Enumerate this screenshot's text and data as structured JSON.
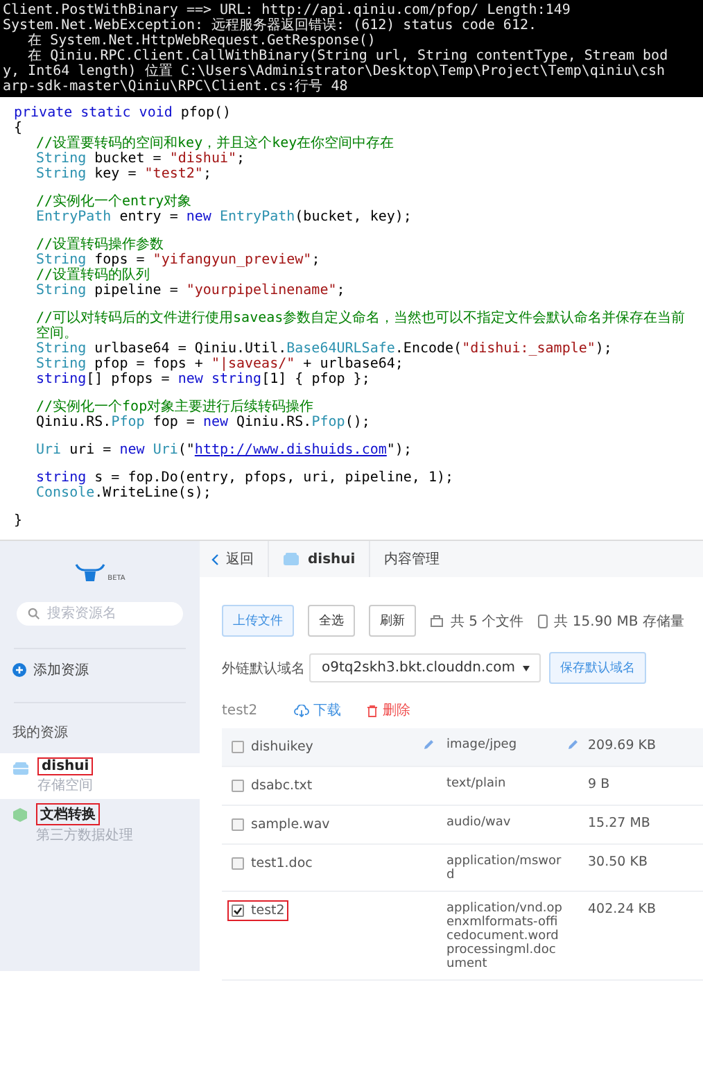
{
  "console": {
    "lines": [
      "Client.PostWithBinary ==> URL: http://api.qiniu.com/pfop/ Length:149",
      "System.Net.WebException: 远程服务器返回错误: (612) status code 612.",
      "   在 System.Net.HttpWebRequest.GetResponse()",
      "   在 Qiniu.RPC.Client.CallWithBinary(String url, String contentType, Stream bod",
      "y, Int64 length) 位置 C:\\Users\\Administrator\\Desktop\\Temp\\Project\\Temp\\qiniu\\csh",
      "arp-sdk-master\\Qiniu\\RPC\\Client.cs:行号 48"
    ]
  },
  "code": {
    "signature": [
      {
        "kind": "kw",
        "text": "private static void"
      },
      {
        "kind": "plain",
        "text": " pfop()"
      }
    ],
    "open_brace": "{",
    "blocks": [
      [
        [
          {
            "kind": "comment",
            "text": "//设置要转码的空间和key，并且这个key在你空间中存在"
          }
        ],
        [
          {
            "kind": "type",
            "text": "String"
          },
          {
            "kind": "plain",
            "text": " bucket = "
          },
          {
            "kind": "str",
            "text": "\"dishui\""
          },
          {
            "kind": "plain",
            "text": ";"
          }
        ],
        [
          {
            "kind": "type",
            "text": "String"
          },
          {
            "kind": "plain",
            "text": " key = "
          },
          {
            "kind": "str",
            "text": "\"test2\""
          },
          {
            "kind": "plain",
            "text": ";"
          }
        ]
      ],
      [
        [
          {
            "kind": "comment",
            "text": "//实例化一个entry对象"
          }
        ],
        [
          {
            "kind": "type",
            "text": "EntryPath"
          },
          {
            "kind": "plain",
            "text": " entry = "
          },
          {
            "kind": "kw",
            "text": "new "
          },
          {
            "kind": "type",
            "text": "EntryPath"
          },
          {
            "kind": "plain",
            "text": "(bucket, key);"
          }
        ]
      ],
      [
        [
          {
            "kind": "comment",
            "text": "//设置转码操作参数"
          }
        ],
        [
          {
            "kind": "type",
            "text": "String"
          },
          {
            "kind": "plain",
            "text": " fops = "
          },
          {
            "kind": "str",
            "text": "\"yifangyun_preview\""
          },
          {
            "kind": "plain",
            "text": ";"
          }
        ],
        [
          {
            "kind": "comment",
            "text": "//设置转码的队列"
          }
        ],
        [
          {
            "kind": "type",
            "text": "String"
          },
          {
            "kind": "plain",
            "text": " pipeline = "
          },
          {
            "kind": "str",
            "text": "\"yourpipelinename\""
          },
          {
            "kind": "plain",
            "text": ";"
          }
        ]
      ],
      [
        [
          {
            "kind": "comment",
            "text": "//可以对转码后的文件进行使用saveas参数自定义命名，当然也可以不指定文件会默认命名并保存在当前空间。"
          }
        ],
        [
          {
            "kind": "type",
            "text": "String"
          },
          {
            "kind": "plain",
            "text": " urlbase64 = Qiniu.Util."
          },
          {
            "kind": "type",
            "text": "Base64URLSafe"
          },
          {
            "kind": "plain",
            "text": ".Encode("
          },
          {
            "kind": "str",
            "text": "\"dishui:_sample\""
          },
          {
            "kind": "plain",
            "text": ");"
          }
        ],
        [
          {
            "kind": "type",
            "text": "String"
          },
          {
            "kind": "plain",
            "text": " pfop = fops + "
          },
          {
            "kind": "str",
            "text": "\"|saveas/\""
          },
          {
            "kind": "plain",
            "text": " + urlbase64;"
          }
        ],
        [
          {
            "kind": "kw",
            "text": "string"
          },
          {
            "kind": "plain",
            "text": "[] pfops = "
          },
          {
            "kind": "kw",
            "text": "new string"
          },
          {
            "kind": "plain",
            "text": "[1] { pfop };"
          }
        ]
      ],
      [
        [
          {
            "kind": "comment",
            "text": "//实例化一个fop对象主要进行后续转码操作"
          }
        ],
        [
          {
            "kind": "plain",
            "text": "Qiniu.RS."
          },
          {
            "kind": "type",
            "text": "Pfop"
          },
          {
            "kind": "plain",
            "text": " fop = "
          },
          {
            "kind": "kw",
            "text": "new"
          },
          {
            "kind": "plain",
            "text": " Qiniu.RS."
          },
          {
            "kind": "type",
            "text": "Pfop"
          },
          {
            "kind": "plain",
            "text": "();"
          }
        ]
      ],
      [
        [
          {
            "kind": "type",
            "text": "Uri"
          },
          {
            "kind": "plain",
            "text": " uri = "
          },
          {
            "kind": "kw",
            "text": "new "
          },
          {
            "kind": "type",
            "text": "Uri"
          },
          {
            "kind": "plain",
            "text": "(\""
          },
          {
            "kind": "link",
            "text": "http://www.dishuids.com"
          },
          {
            "kind": "plain",
            "text": "\");"
          }
        ]
      ],
      [
        [
          {
            "kind": "kw",
            "text": "string"
          },
          {
            "kind": "plain",
            "text": " s = fop.Do(entry, pfops, uri, pipeline, 1);"
          }
        ],
        [
          {
            "kind": "type",
            "text": "Console"
          },
          {
            "kind": "plain",
            "text": ".WriteLine(s);"
          }
        ]
      ]
    ],
    "close_brace": "}"
  },
  "app": {
    "sidebar": {
      "logo_badge": "BETA",
      "search": {
        "placeholder": "搜索资源名"
      },
      "add_label": "添加资源",
      "section_title": "我的资源",
      "items": [
        {
          "kind": "bucket",
          "name": "dishui",
          "subtitle": "存储空间",
          "selected": true,
          "highlighted": true
        },
        {
          "kind": "plugin",
          "name": "文档转换",
          "subtitle": "第三方数据处理",
          "selected": false,
          "highlighted": true
        }
      ]
    },
    "header": {
      "back": "返回",
      "bucket": "dishui",
      "section": "内容管理"
    },
    "toolbar": {
      "buttons": [
        {
          "label": "上传文件",
          "kind": "primary"
        },
        {
          "label": "全选",
          "kind": "default"
        },
        {
          "label": "刷新",
          "kind": "default"
        }
      ],
      "file_count": "共 5 个文件",
      "storage": "共 15.90 MB 存储量"
    },
    "domain": {
      "label": "外链默认域名",
      "value": "o9tq2skh3.bkt.clouddn.com",
      "save": "保存默认域名"
    },
    "selection": {
      "name": "test2",
      "download": "下载",
      "delete": "删除"
    },
    "files": [
      {
        "name": "dishuikey",
        "type": "image/jpeg",
        "size": "209.69 KB",
        "checked": false,
        "hovered": true,
        "highlighted": false
      },
      {
        "name": "dsabc.txt",
        "type": "text/plain",
        "size": "9 B",
        "checked": false,
        "hovered": false,
        "highlighted": false
      },
      {
        "name": "sample.wav",
        "type": "audio/wav",
        "size": "15.27 MB",
        "checked": false,
        "hovered": false,
        "highlighted": false
      },
      {
        "name": "test1.doc",
        "type": "application/msword",
        "size": "30.50 KB",
        "checked": false,
        "hovered": false,
        "highlighted": false
      },
      {
        "name": "test2",
        "type": "application/vnd.openxmlformats-officedocument.wordprocessingml.document",
        "size": "402.24 KB",
        "checked": true,
        "hovered": false,
        "highlighted": true
      }
    ]
  }
}
